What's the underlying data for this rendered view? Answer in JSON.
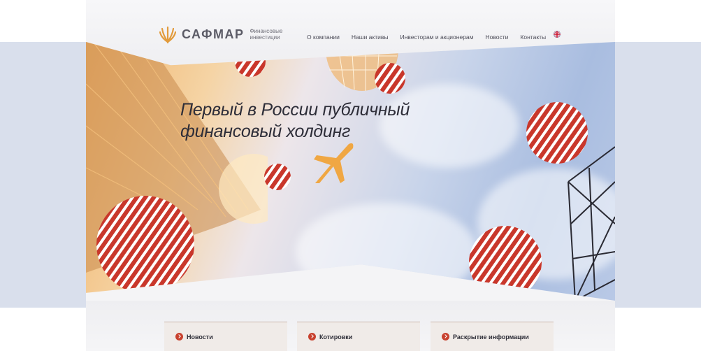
{
  "brand": {
    "name": "САФМАР",
    "subtitle": "Финансовые инвестиции",
    "logo_icon": "wheat-sheaf-icon",
    "accent_color": "#e29b3c"
  },
  "nav": {
    "items": [
      {
        "label": "О компании"
      },
      {
        "label": "Наши активы"
      },
      {
        "label": "Инвесторам и акционерам"
      },
      {
        "label": "Новости"
      },
      {
        "label": "Контакты"
      }
    ],
    "language_icon": "uk-flag-icon"
  },
  "hero": {
    "headline_line1": "Первый в России публичный",
    "headline_line2": "финансовый холдинг"
  },
  "cards": [
    {
      "label": "Новости",
      "icon": "arrow-circle-icon"
    },
    {
      "label": "Котировки",
      "icon": "arrow-circle-icon"
    },
    {
      "label": "Раскрытие информации",
      "icon": "arrow-circle-icon"
    }
  ],
  "colors": {
    "side_band": "#d9dfec",
    "ball_red": "#c9372b",
    "card_icon": "#c8412e"
  }
}
